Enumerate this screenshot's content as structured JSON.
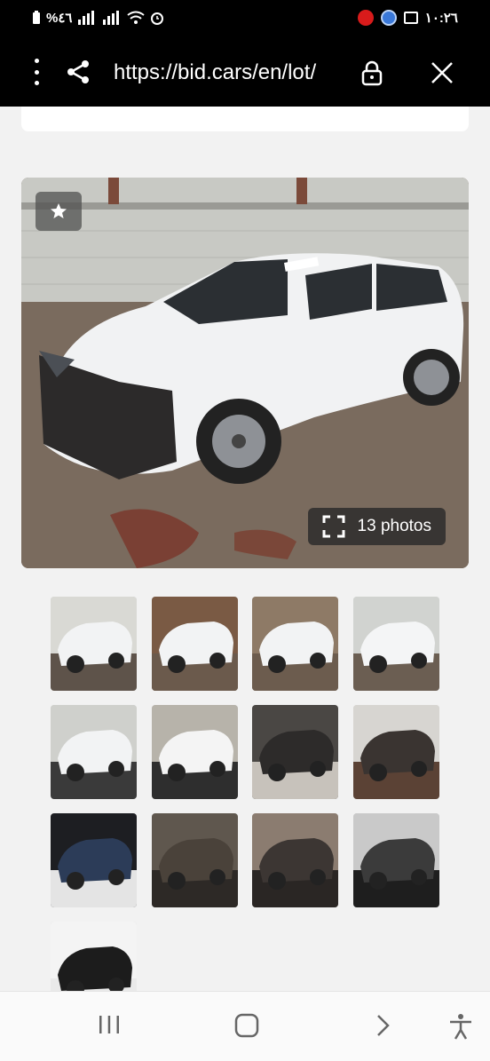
{
  "status_bar": {
    "left_text": "%٤٦",
    "time": "١٠:٢٦"
  },
  "url_bar": {
    "url": "https://bid.cars/en/lot/",
    "icons": [
      "menu-dots-icon",
      "share-icon",
      "lock-icon",
      "close-icon"
    ]
  },
  "gallery": {
    "photo_count_label": "13 photos",
    "thumbnails": [
      {
        "name": "front-left-damage"
      },
      {
        "name": "rear-left"
      },
      {
        "name": "rear-left-side"
      },
      {
        "name": "front-right"
      },
      {
        "name": "front"
      },
      {
        "name": "rear"
      },
      {
        "name": "front-seats"
      },
      {
        "name": "dashboard"
      },
      {
        "name": "instrument-cluster"
      },
      {
        "name": "rear-seats"
      },
      {
        "name": "driver-seat"
      },
      {
        "name": "engine-bay"
      },
      {
        "name": "door-label"
      }
    ]
  },
  "nav_bar": {
    "icons": [
      "recent-apps-icon",
      "home-icon",
      "back-icon",
      "accessibility-icon"
    ]
  },
  "colors": {
    "bar_bg": "#000000",
    "page_bg": "#f2f2f2",
    "overlay": "#3a3a3a"
  }
}
